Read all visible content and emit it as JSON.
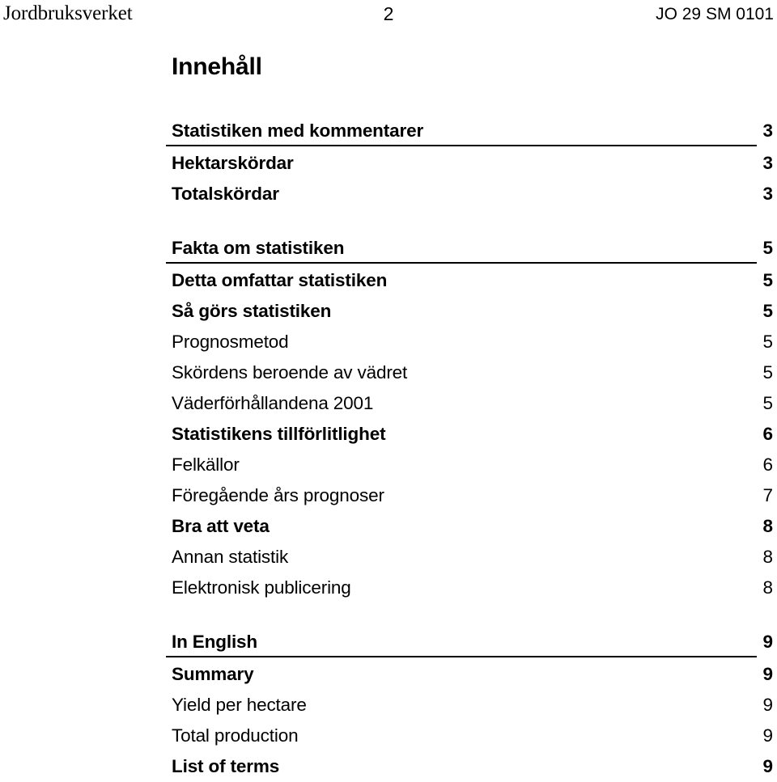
{
  "header": {
    "left": "Jordbruksverket",
    "page_number": "2",
    "right": "JO 29 SM 0101"
  },
  "title": "Innehåll",
  "toc": {
    "groups": [
      {
        "rule_after_first": true,
        "entries": [
          {
            "label": "Statistiken med kommentarer",
            "page": "3",
            "level": 1
          },
          {
            "label": "Hektarskördar",
            "page": "3",
            "level": 2
          },
          {
            "label": "Totalskördar",
            "page": "3",
            "level": 2
          }
        ]
      },
      {
        "rule_after_first": true,
        "entries": [
          {
            "label": "Fakta om statistiken",
            "page": "5",
            "level": 1
          },
          {
            "label": "Detta omfattar statistiken",
            "page": "5",
            "level": 2
          },
          {
            "label": "Så görs statistiken",
            "page": "5",
            "level": 2
          },
          {
            "label": "Prognosmetod",
            "page": "5",
            "level": 3
          },
          {
            "label": "Skördens beroende av vädret",
            "page": "5",
            "level": 3
          },
          {
            "label": "Väderförhållandena 2001",
            "page": "5",
            "level": 3
          },
          {
            "label": "Statistikens tillförlitlighet",
            "page": "6",
            "level": 2
          },
          {
            "label": "Felkällor",
            "page": "6",
            "level": 3
          },
          {
            "label": "Föregående års prognoser",
            "page": "7",
            "level": 3
          },
          {
            "label": "Bra att veta",
            "page": "8",
            "level": 2
          },
          {
            "label": "Annan statistik",
            "page": "8",
            "level": 3
          },
          {
            "label": "Elektronisk publicering",
            "page": "8",
            "level": 3
          }
        ]
      },
      {
        "rule_after_first": true,
        "entries": [
          {
            "label": "In English",
            "page": "9",
            "level": 1
          },
          {
            "label": "Summary",
            "page": "9",
            "level": 2
          },
          {
            "label": "Yield per hectare",
            "page": "9",
            "level": 3
          },
          {
            "label": "Total production",
            "page": "9",
            "level": 3
          },
          {
            "label": "List of terms",
            "page": "9",
            "level": 2
          }
        ]
      }
    ]
  }
}
